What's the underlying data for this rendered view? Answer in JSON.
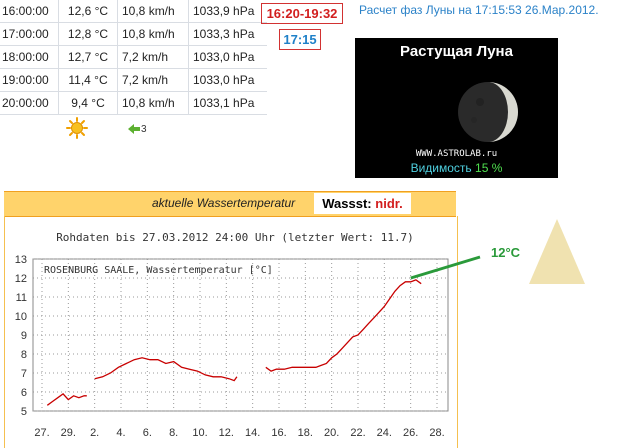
{
  "weather_rows": [
    {
      "time": "16:00:00",
      "temp": "12,6 °C",
      "wind": "10,8 km/h",
      "pressure": "1033,9 hPa"
    },
    {
      "time": "17:00:00",
      "temp": "12,8 °C",
      "wind": "10,8 km/h",
      "pressure": "1033,3 hPa"
    },
    {
      "time": "18:00:00",
      "temp": "12,7 °C",
      "wind": "7,2 km/h",
      "pressure": "1033,0 hPa"
    },
    {
      "time": "19:00:00",
      "temp": "11,4 °C",
      "wind": "7,2 km/h",
      "pressure": "1033,0 hPa"
    },
    {
      "time": "20:00:00",
      "temp": "9,4 °C",
      "wind": "10,8 km/h",
      "pressure": "1033,1 hPa"
    }
  ],
  "weather_icons": {
    "condition": "sun-icon",
    "wind_direction": "wind-arrow-icon",
    "wind_force": "3"
  },
  "time_range": "16:20-19:32",
  "time_now": "17:15",
  "moon": {
    "title": "Расчет фаз Луны на 17:15:53 26.Мар.2012.",
    "phase": "Растущая Луна",
    "site": "WWW.ASTROLAB.ru",
    "visibility_label": "Видимость",
    "visibility_value": "15 %"
  },
  "water": {
    "label": "aktuelle Wassertemperatur",
    "level_label": "Wassst:",
    "level_value": "nidr.",
    "temp_callout": "12°C"
  },
  "colors": {
    "accent_red": "#d21e1e",
    "accent_blue": "#1e80c8",
    "bar_orange": "#ffd36b",
    "series_red": "#c80000",
    "callout_green": "#2a9a3a",
    "triangle": "#f0e2b0"
  },
  "chart_data": {
    "type": "line",
    "title": "Rohdaten bis 27.03.2012 24:00 Uhr (letzter Wert: 11.7)",
    "legend": "ROSENBURG SAALE, Wassertemperatur [°C]",
    "ylim": [
      5,
      13
    ],
    "yticks": [
      "5",
      "6",
      "7",
      "8",
      "9",
      "10",
      "11",
      "12",
      "13"
    ],
    "xticks": [
      "27.",
      "29.",
      "2.",
      "4.",
      "6.",
      "8.",
      "10.",
      "12.",
      "14.",
      "16.",
      "18.",
      "20.",
      "22.",
      "24.",
      "26.",
      "28."
    ],
    "grid": true,
    "series": [
      {
        "segment": 1,
        "points": [
          [
            0.2,
            5.3
          ],
          [
            0.4,
            5.5
          ],
          [
            0.6,
            5.7
          ],
          [
            0.8,
            5.9
          ],
          [
            1.0,
            5.6
          ],
          [
            1.2,
            5.8
          ],
          [
            1.4,
            5.7
          ],
          [
            1.6,
            5.8
          ],
          [
            1.7,
            5.8
          ]
        ]
      },
      {
        "segment": 2,
        "points": [
          [
            2.0,
            6.7
          ],
          [
            2.3,
            6.8
          ],
          [
            2.6,
            7.0
          ],
          [
            2.9,
            7.3
          ],
          [
            3.2,
            7.5
          ],
          [
            3.5,
            7.7
          ],
          [
            3.8,
            7.8
          ],
          [
            4.1,
            7.7
          ],
          [
            4.4,
            7.7
          ],
          [
            4.7,
            7.5
          ],
          [
            5.0,
            7.6
          ],
          [
            5.3,
            7.3
          ],
          [
            5.6,
            7.2
          ],
          [
            5.9,
            7.1
          ],
          [
            6.2,
            6.9
          ],
          [
            6.5,
            6.8
          ],
          [
            6.8,
            6.8
          ],
          [
            7.1,
            6.7
          ],
          [
            7.3,
            6.6
          ],
          [
            7.4,
            6.8
          ]
        ]
      },
      {
        "segment": 3,
        "points": [
          [
            8.5,
            7.3
          ],
          [
            8.7,
            7.1
          ],
          [
            8.9,
            7.2
          ],
          [
            9.2,
            7.2
          ],
          [
            9.5,
            7.3
          ],
          [
            10.0,
            7.3
          ],
          [
            10.4,
            7.3
          ],
          [
            10.6,
            7.4
          ],
          [
            10.8,
            7.5
          ],
          [
            11.0,
            7.8
          ],
          [
            11.2,
            8.0
          ],
          [
            11.4,
            8.3
          ],
          [
            11.6,
            8.6
          ],
          [
            11.8,
            8.9
          ],
          [
            12.0,
            9.0
          ],
          [
            12.2,
            9.3
          ],
          [
            12.4,
            9.6
          ],
          [
            12.6,
            9.9
          ],
          [
            12.8,
            10.2
          ],
          [
            13.0,
            10.5
          ],
          [
            13.2,
            10.9
          ],
          [
            13.4,
            11.3
          ],
          [
            13.6,
            11.6
          ],
          [
            13.8,
            11.8
          ],
          [
            14.0,
            11.8
          ],
          [
            14.2,
            11.9
          ],
          [
            14.4,
            11.7
          ]
        ]
      }
    ]
  }
}
